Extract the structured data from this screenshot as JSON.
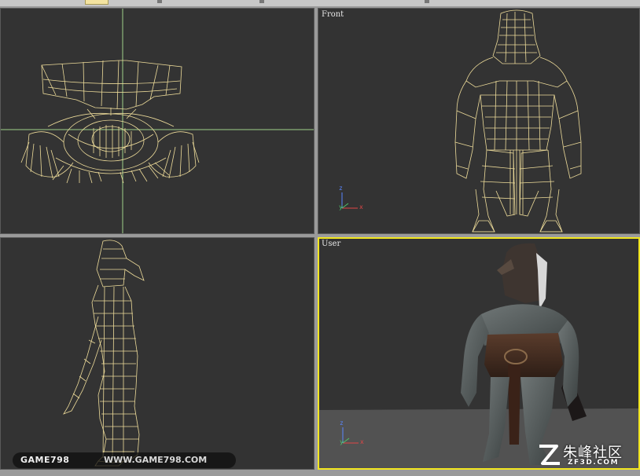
{
  "viewports": {
    "top_left": {
      "label": ""
    },
    "front": {
      "label": "Front"
    },
    "left": {
      "label": ""
    },
    "user": {
      "label": "User",
      "active": true
    }
  },
  "axis_gizmo": {
    "x": "x",
    "y": "y",
    "z": "z"
  },
  "colors": {
    "viewport_bg": "#333333",
    "wireframe": "#eedc9a",
    "active_border": "#f2e61f",
    "grid_line": "#9fd18a"
  },
  "watermarks": {
    "game798": {
      "brand": "GAME798",
      "url": "WWW.GAME798.COM"
    },
    "zf3d": {
      "brand": "朱峰社区",
      "url": "ZF3D.COM"
    }
  }
}
